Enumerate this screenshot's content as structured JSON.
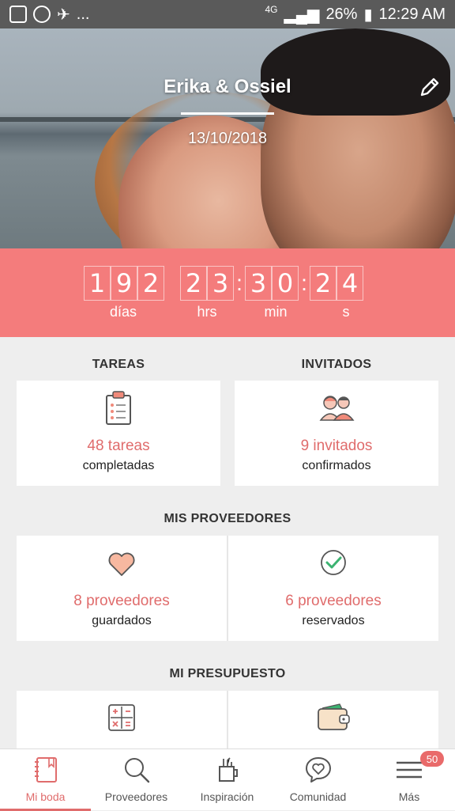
{
  "status_bar": {
    "network": "4G",
    "battery": "26%",
    "time": "12:29 AM",
    "more": "..."
  },
  "hero": {
    "couple_names": "Erika & Ossiel",
    "date": "13/10/2018"
  },
  "countdown": {
    "days": [
      "1",
      "9",
      "2"
    ],
    "hours": [
      "2",
      "3"
    ],
    "minutes": [
      "3",
      "0"
    ],
    "seconds": [
      "2",
      "4"
    ],
    "units": {
      "days": "días",
      "hours": "hrs",
      "minutes": "min",
      "seconds": "s"
    },
    "colors": {
      "background": "#f47c7c"
    }
  },
  "sections": {
    "tareas": {
      "title": "TAREAS",
      "count": "48 tareas",
      "sub": "completadas"
    },
    "invitados": {
      "title": "INVITADOS",
      "count": "9 invitados",
      "sub": "confirmados"
    },
    "proveedores": {
      "title": "MIS PROVEEDORES",
      "saved": {
        "count": "8 proveedores",
        "sub": "guardados"
      },
      "booked": {
        "count": "6 proveedores",
        "sub": "reservados"
      }
    },
    "presupuesto": {
      "title": "MI PRESUPUESTO"
    }
  },
  "bottom_nav": {
    "items": [
      {
        "label": "Mi boda",
        "icon": "notebook-icon",
        "active": true
      },
      {
        "label": "Proveedores",
        "icon": "search-icon"
      },
      {
        "label": "Inspiración",
        "icon": "inspiration-icon"
      },
      {
        "label": "Comunidad",
        "icon": "community-heart-icon"
      },
      {
        "label": "Más",
        "icon": "menu-icon",
        "badge": "50"
      }
    ]
  },
  "colors": {
    "accent": "#e06c6c",
    "status_bar": "#5a5a5a"
  }
}
